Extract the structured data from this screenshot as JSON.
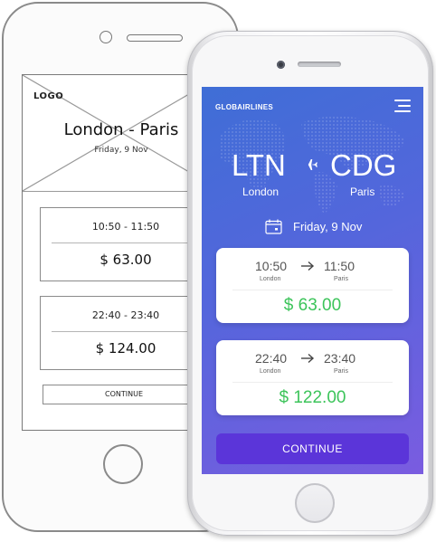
{
  "wireframe": {
    "logo": "LOGO",
    "route": "London - Paris",
    "date": "Friday, 9 Nov",
    "flights": [
      {
        "times": "10:50 - 11:50",
        "price": "$ 63.00"
      },
      {
        "times": "22:40 - 23:40",
        "price": "$ 124.00"
      }
    ],
    "continue_label": "CONTINUE"
  },
  "app": {
    "brand": "GLOBAIRLINES",
    "origin": {
      "code": "LTN",
      "city": "London"
    },
    "destination": {
      "code": "CDG",
      "city": "Paris"
    },
    "date": "Friday, 9 Nov",
    "flights": [
      {
        "depart": "10:50",
        "arrive": "11:50",
        "depart_city": "London",
        "arrive_city": "Paris",
        "price": "$ 63.00"
      },
      {
        "depart": "22:40",
        "arrive": "23:40",
        "depart_city": "London",
        "arrive_city": "Paris",
        "price": "$ 122.00"
      }
    ],
    "continue_label": "CONTINUE"
  },
  "icons": {
    "menu": "hamburger-menu-icon",
    "plane": "airplane-icon",
    "calendar": "calendar-icon",
    "arrow": "arrow-right-icon"
  },
  "colors": {
    "price_green": "#3cc45a",
    "button_purple": "#5b35d9",
    "gradient_start": "#3f6ed6",
    "gradient_end": "#7a5ce0"
  }
}
